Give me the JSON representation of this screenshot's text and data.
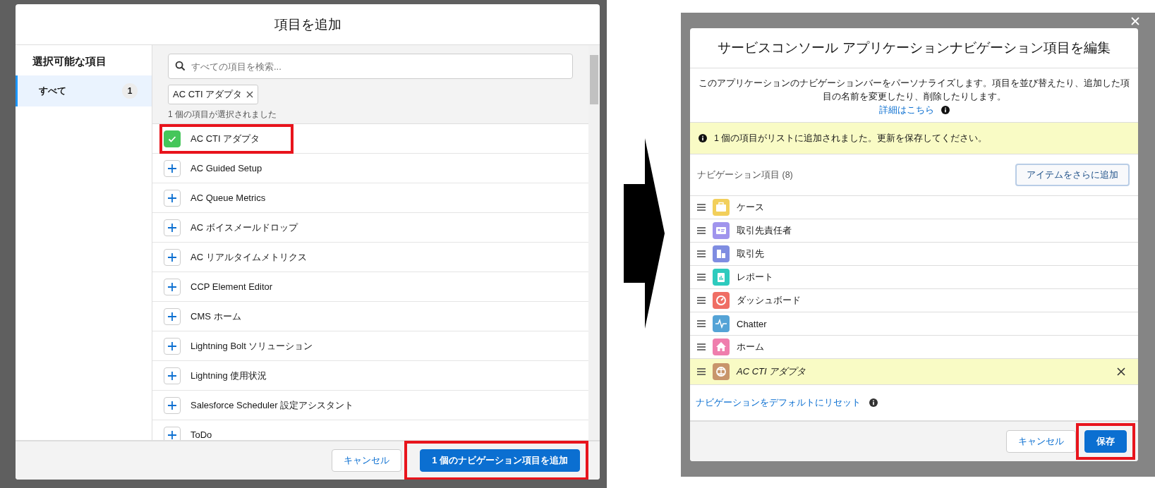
{
  "left_dialog": {
    "title": "項目を追加",
    "sidebar": {
      "heading": "選択可能な項目",
      "items": [
        {
          "label": "すべて",
          "count": "1",
          "selected": true
        }
      ]
    },
    "search": {
      "placeholder": "すべての項目を検索..."
    },
    "chips": [
      {
        "label": "AC CTI アダプタ"
      }
    ],
    "selection_note": "1 個の項目が選択されました",
    "items": [
      {
        "label": "AC CTI アダプタ",
        "checked": true,
        "highlighted": true
      },
      {
        "label": "AC Guided Setup",
        "checked": false,
        "highlighted": false
      },
      {
        "label": "AC Queue Metrics",
        "checked": false,
        "highlighted": false
      },
      {
        "label": "AC ボイスメールドロップ",
        "checked": false,
        "highlighted": false
      },
      {
        "label": "AC リアルタイムメトリクス",
        "checked": false,
        "highlighted": false
      },
      {
        "label": "CCP Element Editor",
        "checked": false,
        "highlighted": false
      },
      {
        "label": "CMS ホーム",
        "checked": false,
        "highlighted": false
      },
      {
        "label": "Lightning Bolt ソリューション",
        "checked": false,
        "highlighted": false
      },
      {
        "label": "Lightning 使用状況",
        "checked": false,
        "highlighted": false
      },
      {
        "label": "Salesforce Scheduler 設定アシスタント",
        "checked": false,
        "highlighted": false
      },
      {
        "label": "ToDo",
        "checked": false,
        "highlighted": false
      }
    ],
    "buttons": [
      {
        "label": "キャンセル",
        "kind": "neutral",
        "highlighted": false
      },
      {
        "label": "1 個のナビゲーション項目を追加",
        "kind": "brand",
        "highlighted": true
      }
    ]
  },
  "right_dialog": {
    "title": "サービスコンソール アプリケーションナビゲーション項目を編集",
    "description": "このアプリケーションのナビゲーションバーをパーソナライズします。項目を並び替えたり、追加した項目の名前を変更したり、削除したりします。",
    "help_link": "詳細はこちら",
    "notice": "1 個の項目がリストに追加されました。更新を保存してください。",
    "list_label": "ナビゲーション項目 (8)",
    "add_button": "アイテムをさらに追加",
    "nav_items": [
      {
        "label": "ケース",
        "kind": "case",
        "color": "#f2cf5b",
        "new": false
      },
      {
        "label": "取引先責任者",
        "kind": "contact",
        "color": "#a094ed",
        "new": false
      },
      {
        "label": "取引先",
        "kind": "account",
        "color": "#7f8de1",
        "new": false
      },
      {
        "label": "レポート",
        "kind": "report",
        "color": "#2ecbbe",
        "new": false
      },
      {
        "label": "ダッシュボード",
        "kind": "dashboard",
        "color": "#ef6e64",
        "new": false
      },
      {
        "label": "Chatter",
        "kind": "chatter",
        "color": "#54a3d6",
        "new": false
      },
      {
        "label": "ホーム",
        "kind": "home",
        "color": "#ef7ead",
        "new": false
      },
      {
        "label": "AC CTI アダプタ",
        "kind": "cti",
        "color": "#c8956b",
        "new": true
      }
    ],
    "reset_link": "ナビゲーションをデフォルトにリセット",
    "buttons": [
      {
        "label": "キャンセル",
        "kind": "neutral",
        "highlighted": false
      },
      {
        "label": "保存",
        "kind": "brand",
        "highlighted": true
      }
    ]
  }
}
